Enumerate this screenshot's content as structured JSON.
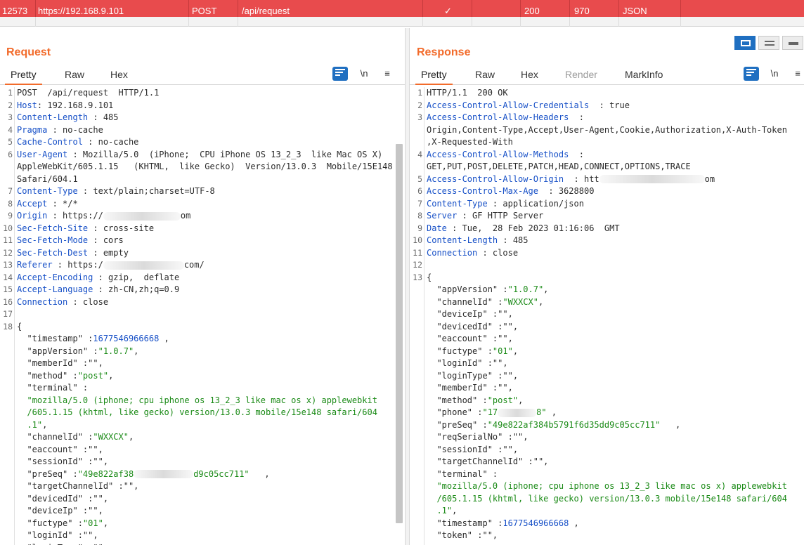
{
  "history_row": {
    "id": "12573",
    "host": "https://192.168.9.101",
    "method": "POST",
    "url": "/api/request",
    "check": "✓",
    "status": "200",
    "length": "970",
    "mime": "JSON"
  },
  "request": {
    "title": "Request",
    "tabs": [
      "Pretty",
      "Raw",
      "Hex"
    ],
    "active_tab": "Pretty",
    "tools": {
      "newline": "\\n",
      "menu": "≡"
    },
    "lines": [
      {
        "n": "1",
        "parts": [
          {
            "t": "POST  /api/request  HTTP/1.1",
            "c": "p"
          }
        ]
      },
      {
        "n": "2",
        "parts": [
          {
            "t": "Host",
            "c": "k"
          },
          {
            "t": ": 192.168.9.101",
            "c": "p"
          }
        ]
      },
      {
        "n": "3",
        "parts": [
          {
            "t": "Content-Length",
            "c": "k"
          },
          {
            "t": " : 485",
            "c": "p"
          }
        ]
      },
      {
        "n": "4",
        "parts": [
          {
            "t": "Pragma",
            "c": "k"
          },
          {
            "t": " : no-cache",
            "c": "p"
          }
        ]
      },
      {
        "n": "5",
        "parts": [
          {
            "t": "Cache-Control",
            "c": "k"
          },
          {
            "t": " : no-cache",
            "c": "p"
          }
        ]
      },
      {
        "n": "6",
        "parts": [
          {
            "t": "User-Agent",
            "c": "k"
          },
          {
            "t": " : Mozilla/5.0  (iPhone;  CPU iPhone OS 13_2_3  like Mac OS X)",
            "c": "p"
          }
        ]
      },
      {
        "n": "",
        "parts": [
          {
            "t": "AppleWebKit/605.1.15   (KHTML,  like Gecko)  Version/13.0.3  Mobile/15E148",
            "c": "p"
          }
        ]
      },
      {
        "n": "",
        "parts": [
          {
            "t": "Safari/604.1",
            "c": "p"
          }
        ]
      },
      {
        "n": "7",
        "parts": [
          {
            "t": "Content-Type",
            "c": "k"
          },
          {
            "t": " : text/plain;charset=UTF-8",
            "c": "p"
          }
        ]
      },
      {
        "n": "8",
        "parts": [
          {
            "t": "Accept",
            "c": "k"
          },
          {
            "t": " : */*",
            "c": "p"
          }
        ]
      },
      {
        "n": "9",
        "parts": [
          {
            "t": "Origin",
            "c": "k"
          },
          {
            "t": " : https://",
            "c": "p"
          },
          {
            "t": "",
            "c": "blur",
            "w": 110
          },
          {
            "t": "om",
            "c": "p"
          }
        ]
      },
      {
        "n": "10",
        "parts": [
          {
            "t": "Sec-Fetch-Site",
            "c": "k"
          },
          {
            "t": " : cross-site",
            "c": "p"
          }
        ]
      },
      {
        "n": "11",
        "parts": [
          {
            "t": "Sec-Fetch-Mode",
            "c": "k"
          },
          {
            "t": " : cors",
            "c": "p"
          }
        ]
      },
      {
        "n": "12",
        "parts": [
          {
            "t": "Sec-Fetch-Dest",
            "c": "k"
          },
          {
            "t": " : empty",
            "c": "p"
          }
        ]
      },
      {
        "n": "13",
        "parts": [
          {
            "t": "Referer",
            "c": "k"
          },
          {
            "t": " : https:/",
            "c": "p"
          },
          {
            "t": "",
            "c": "blur",
            "w": 115
          },
          {
            "t": "com/",
            "c": "p"
          }
        ]
      },
      {
        "n": "14",
        "parts": [
          {
            "t": "Accept-Encoding",
            "c": "k"
          },
          {
            "t": " : gzip,  deflate",
            "c": "p"
          }
        ]
      },
      {
        "n": "15",
        "parts": [
          {
            "t": "Accept-Language",
            "c": "k"
          },
          {
            "t": " : zh-CN,zh;q=0.9",
            "c": "p"
          }
        ]
      },
      {
        "n": "16",
        "parts": [
          {
            "t": "Connection",
            "c": "k"
          },
          {
            "t": " : close",
            "c": "p"
          }
        ]
      },
      {
        "n": "17",
        "parts": []
      },
      {
        "n": "18",
        "parts": [
          {
            "t": "{",
            "c": "p"
          }
        ]
      },
      {
        "n": "",
        "parts": [
          {
            "t": "  \"timestamp\" :",
            "c": "p"
          },
          {
            "t": "1677546966668",
            "c": "n"
          },
          {
            "t": " ,",
            "c": "p"
          }
        ]
      },
      {
        "n": "",
        "parts": [
          {
            "t": "  \"appVersion\" :",
            "c": "p"
          },
          {
            "t": "\"1.0.7\"",
            "c": "s"
          },
          {
            "t": ",",
            "c": "p"
          }
        ]
      },
      {
        "n": "",
        "parts": [
          {
            "t": "  \"memberId\" :\"\",",
            "c": "p"
          }
        ]
      },
      {
        "n": "",
        "parts": [
          {
            "t": "  \"method\" :",
            "c": "p"
          },
          {
            "t": "\"post\"",
            "c": "s"
          },
          {
            "t": ",",
            "c": "p"
          }
        ]
      },
      {
        "n": "",
        "parts": [
          {
            "t": "  \"terminal\" :",
            "c": "p"
          }
        ]
      },
      {
        "n": "",
        "parts": [
          {
            "t": "  \"mozilla/5.0 (iphone; cpu iphone os 13_2_3 like mac os x) applewebkit",
            "c": "s"
          }
        ]
      },
      {
        "n": "",
        "parts": [
          {
            "t": "  /605.1.15 (khtml, like gecko) version/13.0.3 mobile/15e148 safari/604",
            "c": "s"
          }
        ]
      },
      {
        "n": "",
        "parts": [
          {
            "t": "  .1\"",
            "c": "s"
          },
          {
            "t": ",",
            "c": "p"
          }
        ]
      },
      {
        "n": "",
        "parts": [
          {
            "t": "  \"channelId\" :",
            "c": "p"
          },
          {
            "t": "\"WXXCX\"",
            "c": "s"
          },
          {
            "t": ",",
            "c": "p"
          }
        ]
      },
      {
        "n": "",
        "parts": [
          {
            "t": "  \"eaccount\" :\"\",",
            "c": "p"
          }
        ]
      },
      {
        "n": "",
        "parts": [
          {
            "t": "  \"sessionId\" :\"\",",
            "c": "p"
          }
        ]
      },
      {
        "n": "",
        "parts": [
          {
            "t": "  \"preSeq\" :",
            "c": "p"
          },
          {
            "t": "\"49e822af38",
            "c": "s"
          },
          {
            "t": "",
            "c": "blur",
            "w": 85
          },
          {
            "t": "d9c05cc711\"",
            "c": "s"
          },
          {
            "t": "   ,",
            "c": "p"
          }
        ]
      },
      {
        "n": "",
        "parts": [
          {
            "t": "  \"targetChannelId\" :\"\",",
            "c": "p"
          }
        ]
      },
      {
        "n": "",
        "parts": [
          {
            "t": "  \"devicedId\" :\"\",",
            "c": "p"
          }
        ]
      },
      {
        "n": "",
        "parts": [
          {
            "t": "  \"deviceIp\" :\"\",",
            "c": "p"
          }
        ]
      },
      {
        "n": "",
        "parts": [
          {
            "t": "  \"fuctype\" :",
            "c": "p"
          },
          {
            "t": "\"01\"",
            "c": "s"
          },
          {
            "t": ",",
            "c": "p"
          }
        ]
      },
      {
        "n": "",
        "parts": [
          {
            "t": "  \"loginId\" :\"\",",
            "c": "p"
          }
        ]
      },
      {
        "n": "",
        "parts": [
          {
            "t": "  \"loginType\" :\"\",",
            "c": "p"
          }
        ]
      }
    ]
  },
  "response": {
    "title": "Response",
    "tabs": [
      "Pretty",
      "Raw",
      "Hex",
      "Render",
      "MarkInfo"
    ],
    "active_tab": "Pretty",
    "disabled_tab": "Render",
    "tools": {
      "newline": "\\n",
      "menu": "≡"
    },
    "lines": [
      {
        "n": "1",
        "parts": [
          {
            "t": "HTTP/1.1  200 OK",
            "c": "p"
          }
        ]
      },
      {
        "n": "2",
        "parts": [
          {
            "t": "Access-Control-Allow-Credentials",
            "c": "k"
          },
          {
            "t": "  : true",
            "c": "p"
          }
        ]
      },
      {
        "n": "3",
        "parts": [
          {
            "t": "Access-Control-Allow-Headers",
            "c": "k"
          },
          {
            "t": "  :",
            "c": "p"
          }
        ]
      },
      {
        "n": "",
        "parts": [
          {
            "t": "Origin,Content-Type,Accept,User-Agent,Cookie,Authorization,X-Auth-Token",
            "c": "p"
          }
        ]
      },
      {
        "n": "",
        "parts": [
          {
            "t": ",X-Requested-With",
            "c": "p"
          }
        ]
      },
      {
        "n": "4",
        "parts": [
          {
            "t": "Access-Control-Allow-Methods",
            "c": "k"
          },
          {
            "t": "  :",
            "c": "p"
          }
        ]
      },
      {
        "n": "",
        "parts": [
          {
            "t": "GET,PUT,POST,DELETE,PATCH,HEAD,CONNECT,OPTIONS,TRACE",
            "c": "p"
          }
        ]
      },
      {
        "n": "5",
        "parts": [
          {
            "t": "Access-Control-Allow-Origin",
            "c": "k"
          },
          {
            "t": "  : htt",
            "c": "p"
          },
          {
            "t": "",
            "c": "blur",
            "w": 150
          },
          {
            "t": "om",
            "c": "p"
          }
        ]
      },
      {
        "n": "6",
        "parts": [
          {
            "t": "Access-Control-Max-Age",
            "c": "k"
          },
          {
            "t": "  : 3628800",
            "c": "p"
          }
        ]
      },
      {
        "n": "7",
        "parts": [
          {
            "t": "Content-Type",
            "c": "k"
          },
          {
            "t": " : application/json",
            "c": "p"
          }
        ]
      },
      {
        "n": "8",
        "parts": [
          {
            "t": "Server",
            "c": "k"
          },
          {
            "t": " : GF HTTP Server",
            "c": "p"
          }
        ]
      },
      {
        "n": "9",
        "parts": [
          {
            "t": "Date",
            "c": "k"
          },
          {
            "t": " : Tue,  28 Feb 2023 01:16:06  GMT",
            "c": "p"
          }
        ]
      },
      {
        "n": "10",
        "parts": [
          {
            "t": "Content-Length",
            "c": "k"
          },
          {
            "t": " : 485",
            "c": "p"
          }
        ]
      },
      {
        "n": "11",
        "parts": [
          {
            "t": "Connection",
            "c": "k"
          },
          {
            "t": " : close",
            "c": "p"
          }
        ]
      },
      {
        "n": "12",
        "parts": []
      },
      {
        "n": "13",
        "parts": [
          {
            "t": "{",
            "c": "p"
          }
        ]
      },
      {
        "n": "",
        "parts": [
          {
            "t": "  \"appVersion\" :",
            "c": "p"
          },
          {
            "t": "\"1.0.7\"",
            "c": "s"
          },
          {
            "t": ",",
            "c": "p"
          }
        ]
      },
      {
        "n": "",
        "parts": [
          {
            "t": "  \"channelId\" :",
            "c": "p"
          },
          {
            "t": "\"WXXCX\"",
            "c": "s"
          },
          {
            "t": ",",
            "c": "p"
          }
        ]
      },
      {
        "n": "",
        "parts": [
          {
            "t": "  \"deviceIp\" :\"\",",
            "c": "p"
          }
        ]
      },
      {
        "n": "",
        "parts": [
          {
            "t": "  \"devicedId\" :\"\",",
            "c": "p"
          }
        ]
      },
      {
        "n": "",
        "parts": [
          {
            "t": "  \"eaccount\" :\"\",",
            "c": "p"
          }
        ]
      },
      {
        "n": "",
        "parts": [
          {
            "t": "  \"fuctype\" :",
            "c": "p"
          },
          {
            "t": "\"01\"",
            "c": "s"
          },
          {
            "t": ",",
            "c": "p"
          }
        ]
      },
      {
        "n": "",
        "parts": [
          {
            "t": "  \"loginId\" :\"\",",
            "c": "p"
          }
        ]
      },
      {
        "n": "",
        "parts": [
          {
            "t": "  \"loginType\" :\"\",",
            "c": "p"
          }
        ]
      },
      {
        "n": "",
        "parts": [
          {
            "t": "  \"memberId\" :\"\",",
            "c": "p"
          }
        ]
      },
      {
        "n": "",
        "parts": [
          {
            "t": "  \"method\" :",
            "c": "p"
          },
          {
            "t": "\"post\"",
            "c": "s"
          },
          {
            "t": ",",
            "c": "p"
          }
        ]
      },
      {
        "n": "",
        "parts": [
          {
            "t": "  \"phone\" :",
            "c": "p"
          },
          {
            "t": "\"17",
            "c": "s"
          },
          {
            "t": "",
            "c": "blur",
            "w": 55
          },
          {
            "t": "8\"",
            "c": "s"
          },
          {
            "t": " ,",
            "c": "p"
          }
        ]
      },
      {
        "n": "",
        "parts": [
          {
            "t": "  \"preSeq\" :",
            "c": "p"
          },
          {
            "t": "\"49e822af384b5791f6d35dd9c05cc711\"",
            "c": "s"
          },
          {
            "t": "   ,",
            "c": "p"
          }
        ]
      },
      {
        "n": "",
        "parts": [
          {
            "t": "  \"reqSerialNo\" :\"\",",
            "c": "p"
          }
        ]
      },
      {
        "n": "",
        "parts": [
          {
            "t": "  \"sessionId\" :\"\",",
            "c": "p"
          }
        ]
      },
      {
        "n": "",
        "parts": [
          {
            "t": "  \"targetChannelId\" :\"\",",
            "c": "p"
          }
        ]
      },
      {
        "n": "",
        "parts": [
          {
            "t": "  \"terminal\" :",
            "c": "p"
          }
        ]
      },
      {
        "n": "",
        "parts": [
          {
            "t": "  \"mozilla/5.0 (iphone; cpu iphone os 13_2_3 like mac os x) applewebkit",
            "c": "s"
          }
        ]
      },
      {
        "n": "",
        "parts": [
          {
            "t": "  /605.1.15 (khtml, like gecko) version/13.0.3 mobile/15e148 safari/604",
            "c": "s"
          }
        ]
      },
      {
        "n": "",
        "parts": [
          {
            "t": "  .1\"",
            "c": "s"
          },
          {
            "t": ",",
            "c": "p"
          }
        ]
      },
      {
        "n": "",
        "parts": [
          {
            "t": "  \"timestamp\" :",
            "c": "p"
          },
          {
            "t": "1677546966668",
            "c": "n"
          },
          {
            "t": " ,",
            "c": "p"
          }
        ]
      },
      {
        "n": "",
        "parts": [
          {
            "t": "  \"token\" :\"\",",
            "c": "p"
          }
        ]
      }
    ]
  },
  "colors": {
    "history_row_bg": "#e84b4d",
    "accent_orange": "#f26b2b",
    "key_blue": "#1750c7",
    "string_green": "#1a8a16",
    "tool_blue": "#1f6fc1"
  },
  "icons": {
    "wrap": "wrap-lines-icon",
    "layout_side": "layout-side-by-side-icon",
    "layout_stack": "layout-stacked-icon",
    "layout_single": "layout-single-icon"
  }
}
